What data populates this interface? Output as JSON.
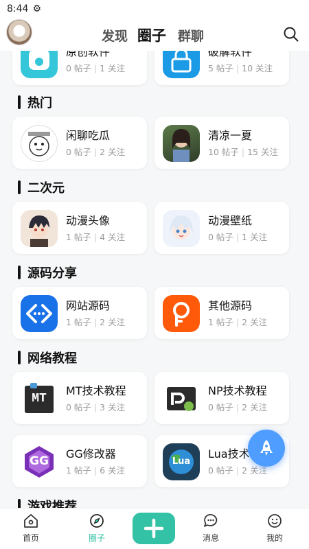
{
  "status": {
    "time": "8:44"
  },
  "header": {
    "tabs": [
      {
        "label": "发现"
      },
      {
        "label": "圈子"
      },
      {
        "label": "群聊"
      }
    ]
  },
  "partial_top": [
    {
      "name": "原创软件",
      "posts": "0 帖子",
      "follows": "1 关注",
      "color": "#35c6d9"
    },
    {
      "name": "破解软件",
      "posts": "5 帖子",
      "follows": "10 关注",
      "color": "#1b9be6"
    }
  ],
  "sections": [
    {
      "title": "热门",
      "items": [
        {
          "name": "闲聊吃瓜",
          "posts": "0 帖子",
          "follows": "2 关注"
        },
        {
          "name": "清凉一夏",
          "posts": "10 帖子",
          "follows": "15 关注"
        }
      ]
    },
    {
      "title": "二次元",
      "items": [
        {
          "name": "动漫头像",
          "posts": "1 帖子",
          "follows": "4 关注"
        },
        {
          "name": "动漫壁纸",
          "posts": "0 帖子",
          "follows": "1 关注"
        }
      ]
    },
    {
      "title": "源码分享",
      "items": [
        {
          "name": "网站源码",
          "posts": "1 帖子",
          "follows": "2 关注"
        },
        {
          "name": "其他源码",
          "posts": "1 帖子",
          "follows": "2 关注"
        }
      ]
    },
    {
      "title": "网络教程",
      "items": [
        {
          "name": "MT技术教程",
          "posts": "0 帖子",
          "follows": "3 关注"
        },
        {
          "name": "NP技术教程",
          "posts": "0 帖子",
          "follows": "2 关注"
        },
        {
          "name": "GG修改器",
          "posts": "1 帖子",
          "follows": "6 关注"
        },
        {
          "name": "Lua技术",
          "posts": "0 帖子",
          "follows": "2 关注"
        }
      ]
    },
    {
      "title": "游戏推荐"
    }
  ],
  "icon_text": {
    "mt": "MT",
    "gg": "GG",
    "lua": "Lua"
  },
  "bottom_nav": [
    {
      "label": "首页"
    },
    {
      "label": "圈子"
    },
    {
      "label": "消息"
    },
    {
      "label": "我的"
    }
  ],
  "colors": {
    "accent": "#33c2a5",
    "fab": "#4f9dff"
  }
}
